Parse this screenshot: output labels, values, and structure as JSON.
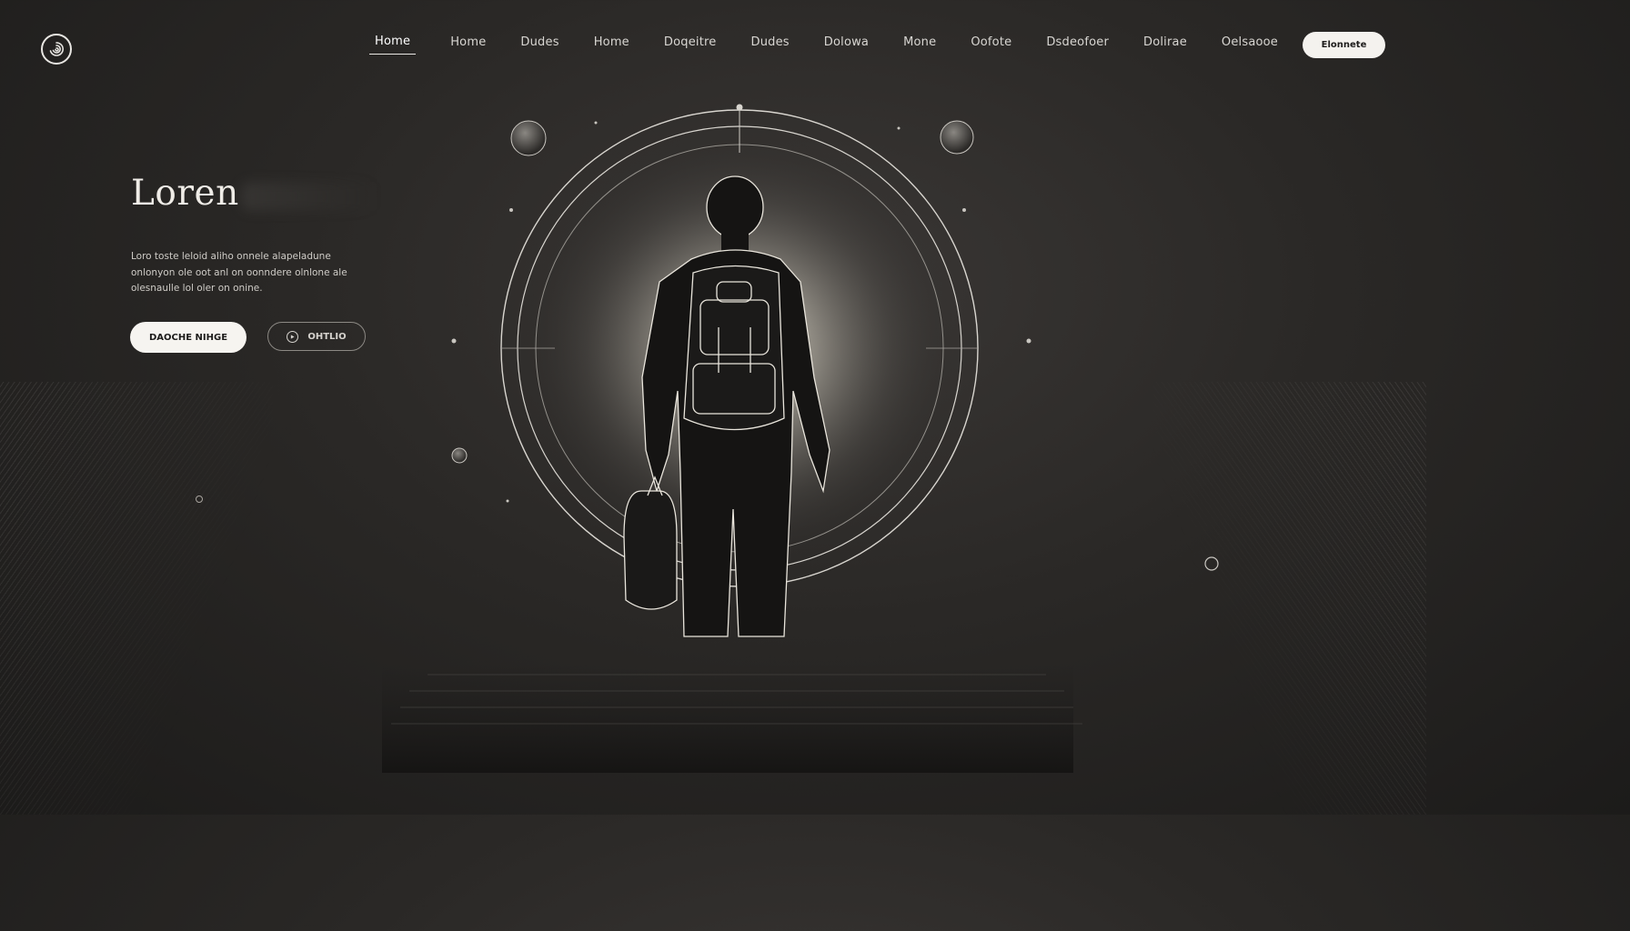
{
  "brand": {
    "logo_icon": "spiral-logo-icon"
  },
  "nav": {
    "items": [
      {
        "label": "Home",
        "active": true
      },
      {
        "label": "Home",
        "active": false
      },
      {
        "label": "Dudes",
        "active": false
      },
      {
        "label": "Home",
        "active": false
      },
      {
        "label": "Doqeitre",
        "active": false
      },
      {
        "label": "Dudes",
        "active": false
      },
      {
        "label": "Dolowa",
        "active": false
      },
      {
        "label": "Mone",
        "active": false
      },
      {
        "label": "Oofote",
        "active": false
      },
      {
        "label": "Dsdeofoer",
        "active": false
      },
      {
        "label": "Dolirae",
        "active": false
      },
      {
        "label": "Oelsaooe",
        "active": false
      }
    ],
    "cta_label": "Elonnete"
  },
  "hero": {
    "title": "Loren",
    "body": "Loro toste leloid aliho onnele alapeladune onlonyon ole oot anl on oonndere olnlone ale olesnaulle lol oler on onine.",
    "primary_button": "DAOCHE NIHGE",
    "secondary_button": "OHTLIO",
    "secondary_icon": "play-icon"
  },
  "colors": {
    "background": "#2a2826",
    "accent": "#f4f2ee",
    "text": "#e8e6e2"
  }
}
